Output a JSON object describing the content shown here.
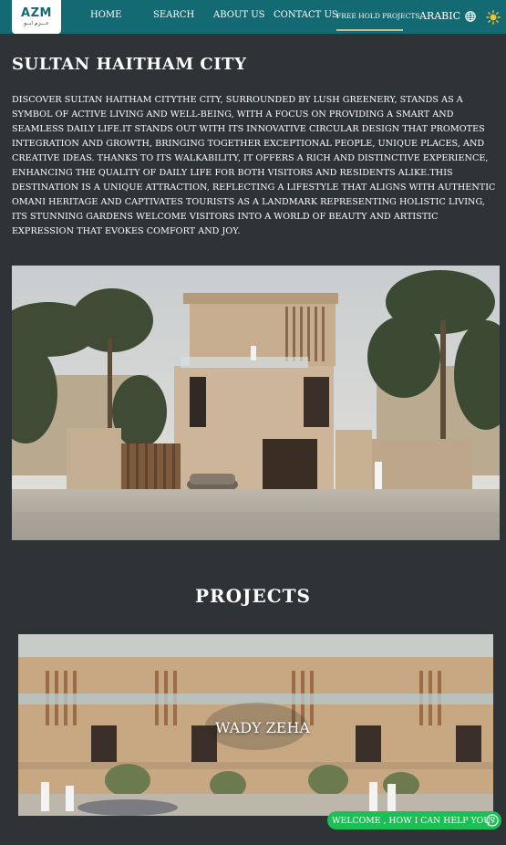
{
  "nav": {
    "logo_text": "AZM",
    "logo_subtext": "عـــزم ابــو",
    "links": [
      "HOME",
      "SEARCH",
      "ABOUT US",
      "CONTACT US",
      "FREE HOLD PROJECTS"
    ],
    "language": "ARABIC",
    "icons": [
      "globe-icon",
      "sun-icon"
    ],
    "colors": {
      "bar": "#146a72",
      "active_underline": "#d7b982"
    }
  },
  "page": {
    "title": "SULTAN HAITHAM CITY",
    "description": "DISCOVER SULTAN HAITHAM CITYTHE CITY, SURROUNDED BY LUSH GREENERY, STANDS AS A SYMBOL OF ACTIVE LIVING AND WELL-BEING, WITH A FOCUS ON PROVIDING A SMART AND SEAMLESS DAILY LIFE.IT STANDS OUT WITH ITS INNOVATIVE CIRCULAR DESIGN THAT PROMOTES INTEGRATION AND GROWTH, BRINGING TOGETHER EXCEPTIONAL PEOPLE, UNIQUE PLACES, AND CREATIVE IDEAS. THANKS TO ITS WALKABILITY, IT OFFERS A RICH AND DISTINCTIVE EXPERIENCE, ENHANCING THE QUALITY OF DAILY LIFE FOR BOTH VISITORS AND RESIDENTS ALIKE.THIS DESTINATION IS A UNIQUE ATTRACTION, REFLECTING A LIFESTYLE THAT ALIGNS WITH AUTHENTIC OMANI HERITAGE AND CAPTIVATES TOURISTS AS A LANDMARK REPRESENTING HOLISTIC LIVING, ITS STUNNING GARDENS WELCOME VISITORS INTO A WORLD OF BEAUTY AND ARTISTIC EXPRESSION THAT EVOKES COMFORT AND JOY.",
    "background": "#2e3336"
  },
  "projects": {
    "heading": "PROJECTS",
    "items": [
      {
        "name": "WADY ZEHA"
      }
    ]
  },
  "chat": {
    "text": "WELCOME , HOW I CAN HELP YOU?",
    "icon": "whatsapp-icon",
    "color": "#1ebe57"
  }
}
